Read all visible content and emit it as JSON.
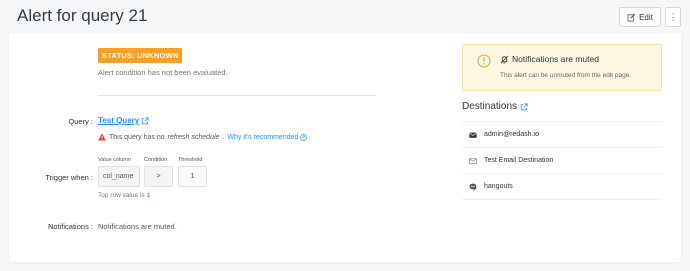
{
  "header": {
    "title": "Alert for query 21",
    "edit_label": "Edit",
    "more_label": "⋮"
  },
  "status": {
    "badge": "STATUS: UNKNOWN",
    "description": "Alert condition has not been evaluated.",
    "badge_color": "#f7a12a"
  },
  "query": {
    "label": "Query :",
    "link_text": "Test Query",
    "warning_prefix": "This query has no",
    "warning_em": "refresh schedule",
    "warning_suffix": ".",
    "why_link": "Why it's recommended"
  },
  "trigger": {
    "label": "Trigger when :",
    "value_column_header": "Value column",
    "condition_header": "Condition",
    "threshold_header": "Threshold",
    "value_column": "col_name",
    "condition": ">",
    "threshold": "1",
    "top_row_prefix": "Top row value is",
    "top_row_value": "1"
  },
  "notifications": {
    "label": "Notifications :",
    "text": "Notifications are muted."
  },
  "muted_alert": {
    "title": "Notifications are muted",
    "description": "This alert can be unmuted from the edit page."
  },
  "destinations": {
    "title": "Destinations",
    "items": [
      {
        "label": "admin@redash.io",
        "icon": "envelope-solid-icon"
      },
      {
        "label": "Test Email Destination",
        "icon": "envelope-outline-icon"
      },
      {
        "label": "hangouts",
        "icon": "hangouts-icon"
      }
    ]
  },
  "colors": {
    "link": "#2196f3",
    "warning_bg": "#fdf8e3",
    "danger": "#d32f2f"
  }
}
